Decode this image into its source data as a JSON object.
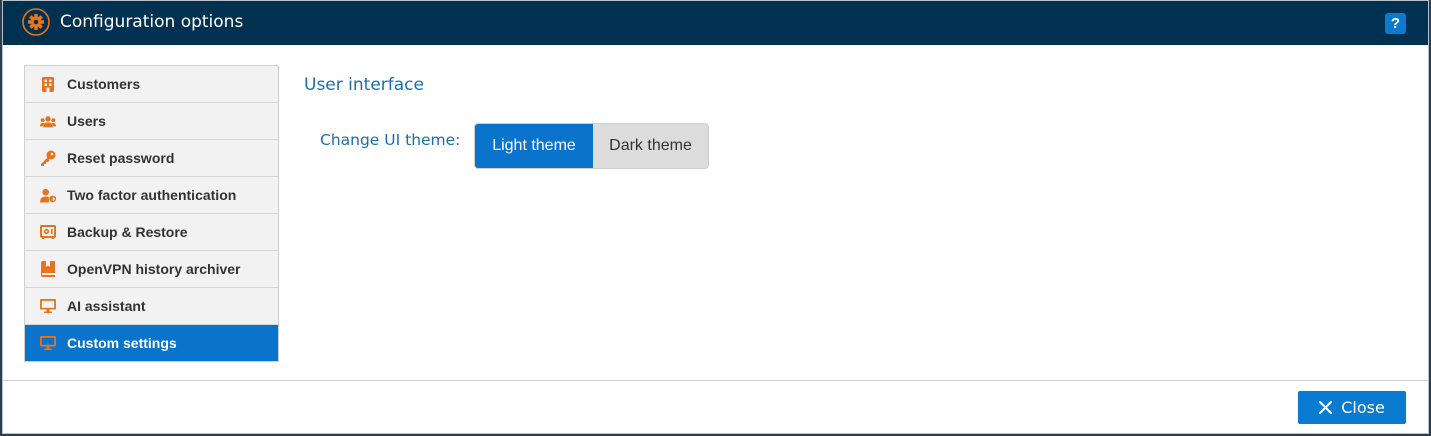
{
  "window": {
    "title": "Configuration options",
    "help_label": "?"
  },
  "sidebar": {
    "items": [
      {
        "label": "Customers",
        "icon": "building-icon",
        "active": false
      },
      {
        "label": "Users",
        "icon": "users-icon",
        "active": false
      },
      {
        "label": "Reset password",
        "icon": "key-icon",
        "active": false
      },
      {
        "label": "Two factor authentication",
        "icon": "user-shield-icon",
        "active": false
      },
      {
        "label": "Backup & Restore",
        "icon": "safe-icon",
        "active": false
      },
      {
        "label": "OpenVPN history archiver",
        "icon": "book-icon",
        "active": false
      },
      {
        "label": "AI assistant",
        "icon": "monitor-icon",
        "active": false
      },
      {
        "label": "Custom settings",
        "icon": "monitor-icon",
        "active": true
      }
    ]
  },
  "main": {
    "section_title": "User interface",
    "theme": {
      "label": "Change UI theme:",
      "options": [
        "Light theme",
        "Dark theme"
      ],
      "selected": "Light theme"
    }
  },
  "footer": {
    "close_label": "Close"
  },
  "colors": {
    "titlebar": "#003150",
    "accent": "#0a74cc",
    "icon_orange": "#e8731a",
    "text_blue": "#1a6fae"
  }
}
